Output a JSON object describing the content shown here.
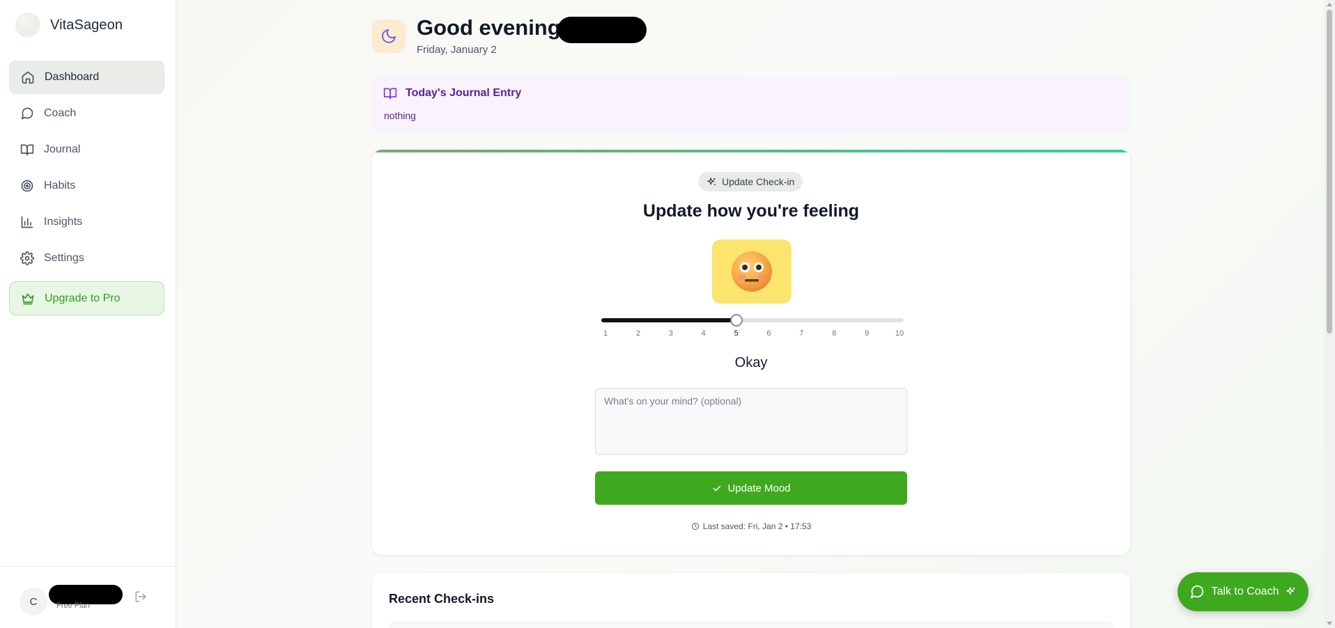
{
  "sidebar": {
    "brand": "VitaSageon",
    "items": [
      {
        "label": "Dashboard",
        "icon": "home-icon",
        "active": true
      },
      {
        "label": "Coach",
        "icon": "chat-icon",
        "active": false
      },
      {
        "label": "Journal",
        "icon": "book-icon",
        "active": false
      },
      {
        "label": "Habits",
        "icon": "target-icon",
        "active": false
      },
      {
        "label": "Insights",
        "icon": "bar-chart-icon",
        "active": false
      },
      {
        "label": "Settings",
        "icon": "gear-icon",
        "active": false
      }
    ],
    "upgrade_label": "Upgrade to Pro",
    "user": {
      "avatar_initial": "C",
      "plan": "Free Plan"
    }
  },
  "header": {
    "greeting": "Good evening,",
    "date": "Friday, January 2"
  },
  "journal": {
    "title": "Today's Journal Entry",
    "text": "nothing"
  },
  "checkin": {
    "badge": "Update Check-in",
    "heading": "Update how you're feeling",
    "mood_value": 5,
    "scale": [
      "1",
      "2",
      "3",
      "4",
      "5",
      "6",
      "7",
      "8",
      "9",
      "10"
    ],
    "mood_label": "Okay",
    "note_placeholder": "What's on your mind? (optional)",
    "button_label": "Update Mood",
    "last_saved": "Last saved: Fri, Jan 2 • 17:53"
  },
  "recent": {
    "title": "Recent Check-ins"
  },
  "coach_fab": {
    "label": "Talk to Coach"
  },
  "colors": {
    "accent_green": "#3ea91f",
    "journal_purple": "#5b2296",
    "emoji_bg": "#fbe56d"
  }
}
